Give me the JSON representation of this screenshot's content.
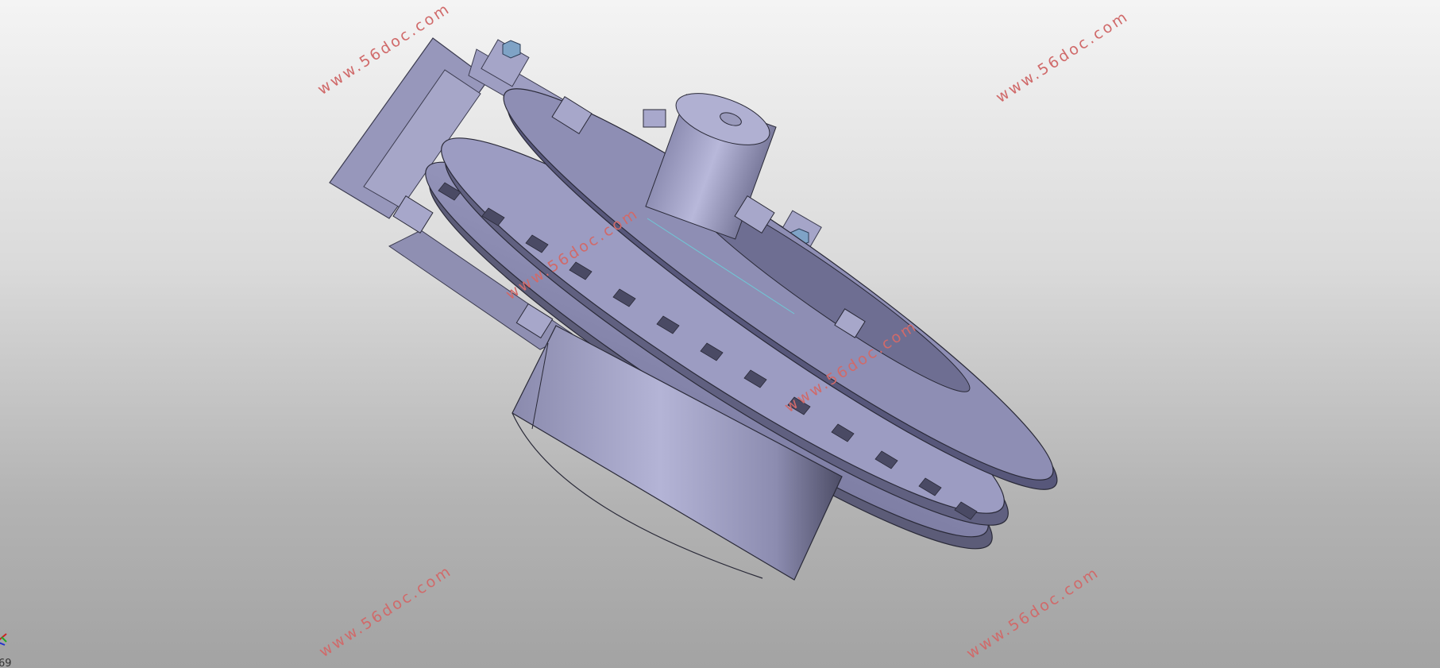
{
  "viewport": {
    "background_top": "#f4f4f4",
    "background_bottom": "#a3a3a3"
  },
  "model": {
    "name": "cad-assembly",
    "body_color": "#a8a8cc",
    "shadow_color": "#5f5f7a",
    "screw_color": "#7fa3c6"
  },
  "watermarks": [
    "www.56doc.com",
    "www.56doc.com",
    "www.56doc.com",
    "www.56doc.com",
    "www.56doc.com",
    "www.56doc.com"
  ],
  "triad": {
    "icon": "axis-triad-icon",
    "x_color": "#cc2222",
    "y_color": "#22aa22",
    "z_color": "#2233cc"
  },
  "corner_label": "69"
}
